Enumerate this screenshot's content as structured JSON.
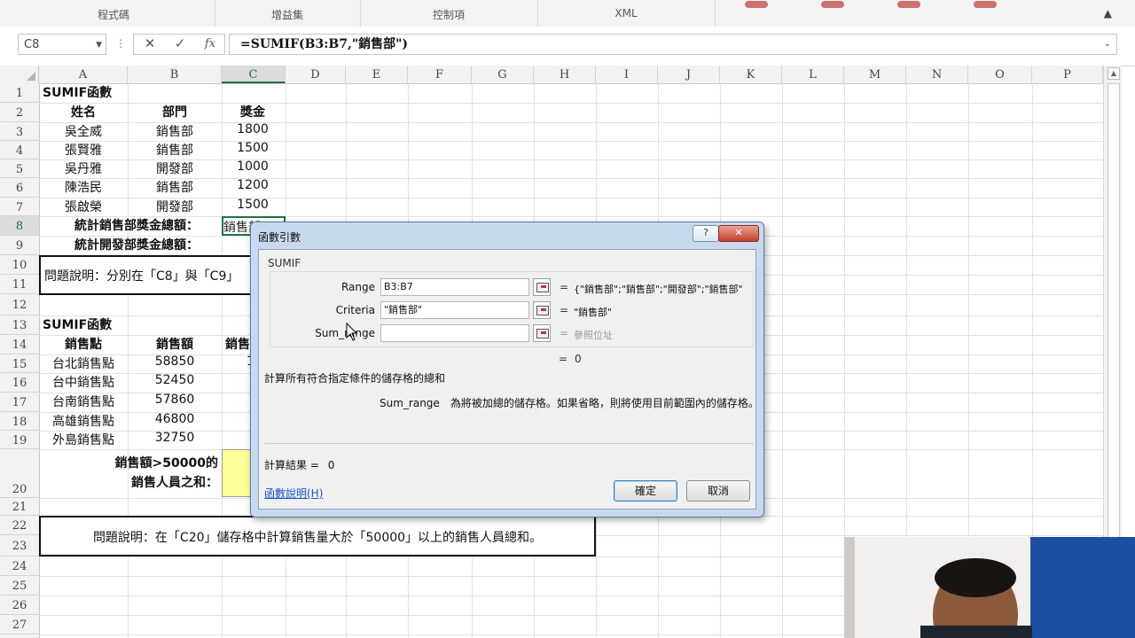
{
  "ribbon": {
    "groups": [
      {
        "label": "程式碼"
      },
      {
        "label": "增益集"
      },
      {
        "label": "控制項"
      },
      {
        "label": "XML"
      }
    ],
    "collapse_icon": "chevron-up-icon"
  },
  "formula_bar": {
    "name_box": "C8",
    "cancel_icon": "✕",
    "enter_icon": "✓",
    "fx_label": "fx",
    "formula": "=SUMIF(B3:B7,\"銷售部\")"
  },
  "columns": [
    "A",
    "B",
    "C",
    "D",
    "E",
    "F",
    "G",
    "H",
    "I",
    "J",
    "K",
    "L",
    "M",
    "N",
    "O",
    "P"
  ],
  "rows": [
    "1",
    "2",
    "3",
    "4",
    "5",
    "6",
    "7",
    "8",
    "9",
    "10",
    "11",
    "12",
    "13",
    "14",
    "15",
    "16",
    "17",
    "18",
    "19",
    "20",
    "21",
    "22",
    "23",
    "24",
    "25",
    "26",
    "27"
  ],
  "table1": {
    "title": "SUMIF函數",
    "headers": [
      "姓名",
      "部門",
      "獎金"
    ],
    "rows": [
      [
        "吳全威",
        "銷售部",
        "1800"
      ],
      [
        "張賢雅",
        "銷售部",
        "1500"
      ],
      [
        "吳丹雅",
        "開發部",
        "1000"
      ],
      [
        "陳浩民",
        "銷售部",
        "1200"
      ],
      [
        "張啟榮",
        "開發部",
        "1500"
      ]
    ],
    "label_c8": "統計銷售部獎金總額：",
    "label_c9": "統計開發部獎金總額：",
    "active_cell_text": "銷售部\")",
    "note": "問題說明：分別在「C8」與「C9」"
  },
  "table2": {
    "title": "SUMIF函數",
    "headers": [
      "銷售點",
      "銷售額",
      "銷售"
    ],
    "rows": [
      [
        "台北銷售點",
        "58850",
        "1"
      ],
      [
        "台中銷售點",
        "52450",
        ""
      ],
      [
        "台南銷售點",
        "57860",
        ""
      ],
      [
        "高雄銷售點",
        "46800",
        ""
      ],
      [
        "外島銷售點",
        "32750",
        ""
      ]
    ],
    "label_line1": "銷售額>50000的",
    "label_line2": "銷售人員之和：",
    "note": "問題說明：在「C20」儲存格中計算銷售量大於「50000」以上的銷售人員總和。"
  },
  "dialog": {
    "title": "函數引數",
    "help_label": "?",
    "close_label": "✕",
    "function_name": "SUMIF",
    "args": [
      {
        "name": "Range",
        "value": "B3:B7",
        "result": "{\"銷售部\";\"銷售部\";\"開發部\";\"銷售部\"",
        "placeholder": false
      },
      {
        "name": "Criteria",
        "value": "\"銷售部\"",
        "result": "\"銷售部\"",
        "placeholder": false
      },
      {
        "name": "Sum_range",
        "value": "",
        "result": "參照位址",
        "placeholder": true
      }
    ],
    "formula_result_line": "0",
    "description": "計算所有符合指定條件的儲存格的總和",
    "arg_desc_name": "Sum_range",
    "arg_desc_text": "為將被加總的儲存格。如果省略，則將使用目前範圍內的儲存格。",
    "result_label": "計算結果 =",
    "result_value": "0",
    "help_link": "函數說明(H)",
    "ok_label": "確定",
    "cancel_label": "取消"
  }
}
